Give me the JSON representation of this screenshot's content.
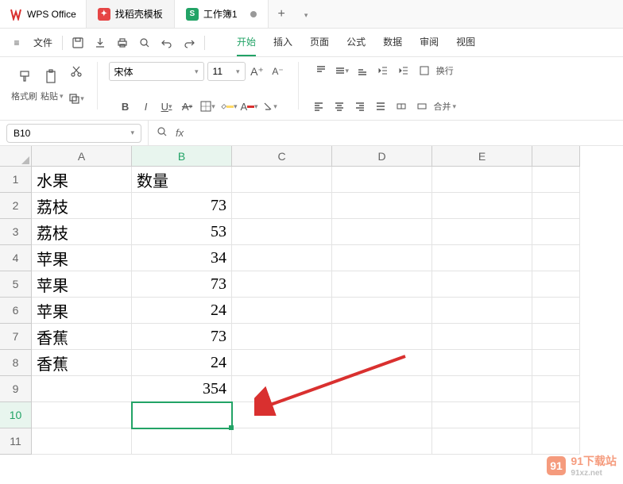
{
  "titlebar": {
    "app_name": "WPS Office",
    "template_tab": "找稻壳模板",
    "doc_tab": "工作簿1",
    "newtab": "+"
  },
  "menubar": {
    "hamburger": "≡",
    "file": "文件",
    "tabs": [
      "开始",
      "插入",
      "页面",
      "公式",
      "数据",
      "审阅",
      "视图"
    ]
  },
  "ribbon": {
    "format_painter": "格式刷",
    "paste": "粘贴",
    "font_name": "宋体",
    "font_size": "11",
    "wrap": "换行",
    "merge": "合并"
  },
  "fxbar": {
    "namebox": "B10",
    "fx": "fx"
  },
  "grid": {
    "cols": [
      "A",
      "B",
      "C",
      "D",
      "E"
    ],
    "rows": [
      "1",
      "2",
      "3",
      "4",
      "5",
      "6",
      "7",
      "8",
      "9",
      "10",
      "11"
    ],
    "data": {
      "A1": "水果",
      "B1": "数量",
      "A2": "荔枝",
      "B2": "73",
      "A3": "荔枝",
      "B3": "53",
      "A4": "苹果",
      "B4": "34",
      "A5": "苹果",
      "B5": "73",
      "A6": "苹果",
      "B6": "24",
      "A7": "香蕉",
      "B7": "73",
      "A8": "香蕉",
      "B8": "24",
      "B9": "354"
    },
    "selected": "B10"
  },
  "watermark": {
    "brand": "91下载站",
    "url": "91xz.net"
  }
}
